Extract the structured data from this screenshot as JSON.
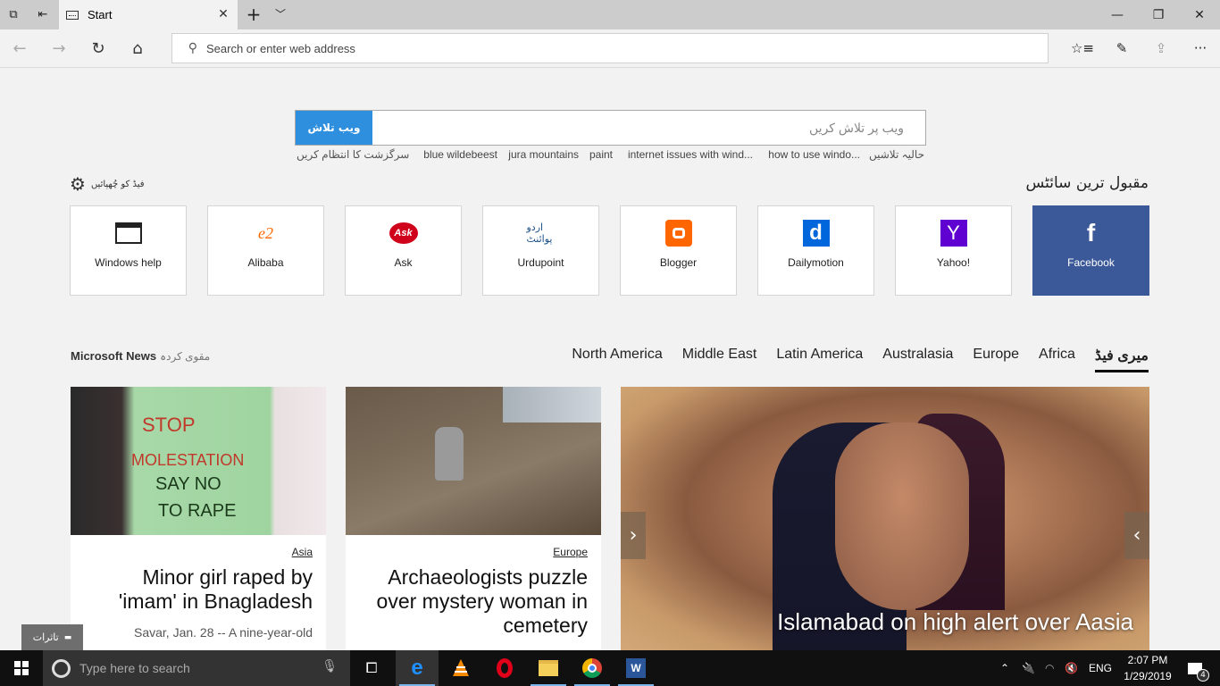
{
  "browser": {
    "tab": {
      "title": "Start"
    },
    "address_bar": {
      "placeholder": "Search or enter web address"
    }
  },
  "bing": {
    "button_label": "ویب تلاش",
    "placeholder": "ویب پر تلاش کریں",
    "recent_label": "حالیہ تلاشیں",
    "recent_searches": [
      "how to use windo...",
      "internet issues with wind...",
      "paint",
      "jura mountains",
      "blue wildebeest"
    ],
    "manage_history": "سرگزشت کا انتظام کریں"
  },
  "top_sites": {
    "heading": "مقبول ترین سائٹس",
    "hide_feed": "فیڈ کو چُھپائیں",
    "sites": [
      {
        "name": "Facebook",
        "icon": "facebook-icon",
        "color": "#3b5998"
      },
      {
        "name": "Yahoo!",
        "icon": "yahoo-icon",
        "color": "#5f01d1"
      },
      {
        "name": "Dailymotion",
        "icon": "dailymotion-icon",
        "color": "#0066dc"
      },
      {
        "name": "Blogger",
        "icon": "blogger-icon",
        "color": "#ff6600"
      },
      {
        "name": "Urdupoint",
        "icon": "urdupoint-icon",
        "color": "#1a4f8a"
      },
      {
        "name": "Ask",
        "icon": "ask-icon",
        "color": "#d0021b"
      },
      {
        "name": "Alibaba",
        "icon": "alibaba-icon",
        "color": "#ff6a00"
      },
      {
        "name": "Windows help",
        "icon": "window-icon",
        "color": "#222222"
      }
    ]
  },
  "news": {
    "brand": "Microsoft News",
    "powered_by": "مقوی کردہ",
    "regions": [
      {
        "label": "میری فیڈ",
        "active": true
      },
      {
        "label": "Africa"
      },
      {
        "label": "Europe"
      },
      {
        "label": "Australasia"
      },
      {
        "label": "Latin America"
      },
      {
        "label": "Middle East"
      },
      {
        "label": "North America"
      }
    ],
    "hero": {
      "headline": "Islamabad on high alert over Aasia"
    },
    "cards": [
      {
        "category": "Europe",
        "headline": "Archaeologists puzzle over mystery woman in cemetery"
      },
      {
        "category": "Asia",
        "headline": "Minor girl raped by 'imam' in Bnagladesh",
        "snippet": "Savar, Jan. 28 -- A nine-year-old"
      }
    ],
    "feedback_label": "تاثرات"
  },
  "taskbar": {
    "search_placeholder": "Type here to search",
    "apps": [
      "edge",
      "vlc",
      "opera",
      "file-explorer",
      "chrome",
      "word"
    ],
    "language": "ENG",
    "time": "2:07 PM",
    "date": "1/29/2019",
    "notification_count": "4"
  }
}
